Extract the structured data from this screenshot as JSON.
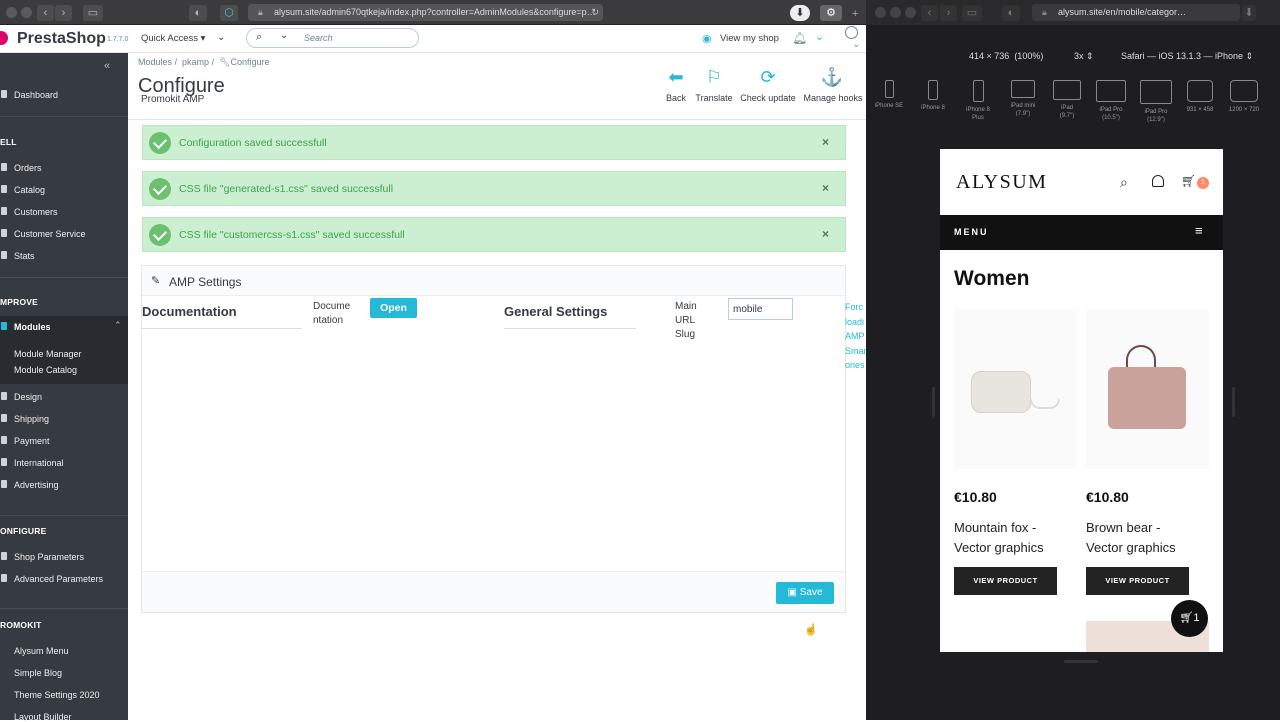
{
  "browser_left": {
    "url": "alysum.site/admin670qtkeja/index.php?controller=AdminModules&configure=p…"
  },
  "browser_right": {
    "url": "alysum.site/en/mobile/categor…"
  },
  "header": {
    "logo": "PrestaShop",
    "version": "1.7.7.0",
    "quick_access": "Quick Access",
    "search_placeholder": "Search",
    "view_shop": "View my shop"
  },
  "sidebar": {
    "items": [
      {
        "label": "Dashboard"
      },
      {
        "label": "Orders"
      },
      {
        "label": "Catalog"
      },
      {
        "label": "Customers"
      },
      {
        "label": "Customer Service"
      },
      {
        "label": "Stats"
      },
      {
        "label": "Modules"
      },
      {
        "label": "Module Manager"
      },
      {
        "label": "Module Catalog"
      },
      {
        "label": "Design"
      },
      {
        "label": "Shipping"
      },
      {
        "label": "Payment"
      },
      {
        "label": "International"
      },
      {
        "label": "Advertising"
      },
      {
        "label": "Shop Parameters"
      },
      {
        "label": "Advanced Parameters"
      },
      {
        "label": "Alysum Menu"
      },
      {
        "label": "Simple Blog"
      },
      {
        "label": "Theme Settings 2020"
      },
      {
        "label": "Layout Builder"
      }
    ],
    "sections": [
      "ELL",
      "MPROVE",
      "ONFIGURE",
      "ROMOKIT"
    ]
  },
  "breadcrumb": [
    "Modules",
    "pkamp",
    "Configure"
  ],
  "page": {
    "title": "Configure",
    "subtitle": "Promokit AMP"
  },
  "toolbar": {
    "back": "Back",
    "translate": "Translate",
    "check_update": "Check update",
    "manage_hooks": "Manage hooks"
  },
  "alerts": [
    {
      "text": "Configuration saved successfull"
    },
    {
      "text": "CSS file \"generated-s1.css\" saved successfull"
    },
    {
      "text": "CSS file \"customercss-s1.css\" saved successfull"
    }
  ],
  "panel": {
    "heading": "AMP Settings",
    "documentation_title": "Documentation",
    "documentation_label_1": "Docume",
    "documentation_label_2": "ntation",
    "open_button": "Open",
    "general_title": "General Settings",
    "slug_label_1": "Main",
    "slug_label_2": "URL",
    "slug_label_3": "Slug",
    "slug_value": "mobile",
    "side_text": [
      "Forc",
      "loadi",
      "AMP",
      "Smar",
      "ones"
    ],
    "save_button": "Save"
  },
  "simulator": {
    "viewport": "414 × 736",
    "zoom": "(100%)",
    "scale": "3x",
    "device": "Safari — iOS 13.1.3 — iPhone",
    "devices": [
      {
        "name": "iPhone SE",
        "sub": ""
      },
      {
        "name": "iPhone 8",
        "sub": ""
      },
      {
        "name": "iPhone 8",
        "sub": "Plus"
      },
      {
        "name": "iPad mini",
        "sub": "(7.9\")"
      },
      {
        "name": "iPad",
        "sub": "(9.7\")"
      },
      {
        "name": "iPad Pro",
        "sub": "(10.5\")"
      },
      {
        "name": "iPad Pro",
        "sub": "(12.9\")"
      },
      {
        "name": "931 × 458",
        "sub": ""
      },
      {
        "name": "1200 × 720",
        "sub": ""
      }
    ]
  },
  "phone": {
    "brand": "ALYSUM",
    "cart_count": "1",
    "menu": "MENU",
    "category": "Women",
    "products": [
      {
        "price": "€10.80",
        "name_1": "Mountain fox -",
        "name_2": "Vector graphics",
        "button": "VIEW PRODUCT"
      },
      {
        "price": "€10.80",
        "name_1": "Brown bear -",
        "name_2": "Vector graphics",
        "button": "VIEW PRODUCT"
      }
    ],
    "floating_cart_count": "1"
  }
}
